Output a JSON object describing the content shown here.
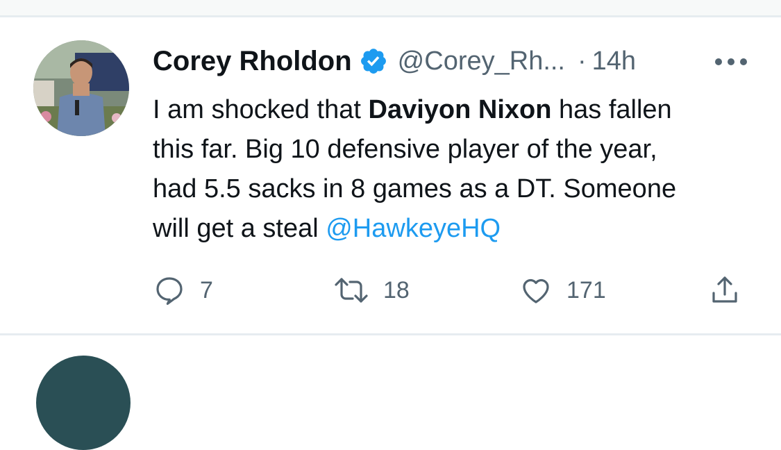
{
  "tweet": {
    "author": {
      "display_name": "Corey Rholdon",
      "verified": true,
      "handle": "@Corey_Rh...",
      "avatar": "profile-photo"
    },
    "separator": "·",
    "time": "14h",
    "text": {
      "line1_before": "I am shocked that ",
      "line1_bold": "Daviyon Nixon",
      "line1_after": " has fallen",
      "line2": "this far. Big 10 defensive player of the year,",
      "line3": "had 5.5 sacks in 8 games as a DT. Someone",
      "line4_before": "will get a steal ",
      "line4_mention": "@HawkeyeHQ"
    },
    "actions": {
      "reply_count": "7",
      "retweet_count": "18",
      "like_count": "171"
    }
  },
  "colors": {
    "accent": "#1d9bf0",
    "muted_text": "#536471",
    "primary_text": "#0f1419",
    "divider": "#e6ecf0"
  },
  "icons": [
    "verified-badge-icon",
    "more-options-icon",
    "reply-icon",
    "retweet-icon",
    "like-icon",
    "share-icon"
  ]
}
